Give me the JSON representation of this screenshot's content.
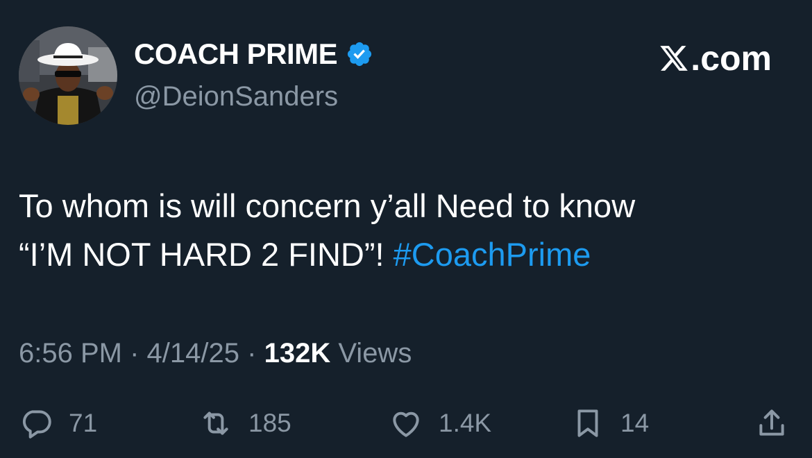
{
  "user": {
    "display_name": "COACH PRIME",
    "handle": "@DeionSanders"
  },
  "brand": {
    "label": ".com",
    "icon": "x-logo-icon"
  },
  "tweet": {
    "text_line1": "To whom is will concern y’all Need to know",
    "text_line2": "“I’M NOT HARD 2 FIND”!",
    "hashtag": "#CoachPrime"
  },
  "meta": {
    "time": "6:56 PM",
    "separator": "·",
    "date": "4/14/25",
    "views_count": "132K",
    "views_label": "Views"
  },
  "actions": {
    "replies": "71",
    "reposts": "185",
    "likes": "1.4K",
    "bookmarks": "14"
  },
  "colors": {
    "background": "#15202b",
    "accent": "#1d9bf0",
    "muted": "#8b98a5"
  }
}
